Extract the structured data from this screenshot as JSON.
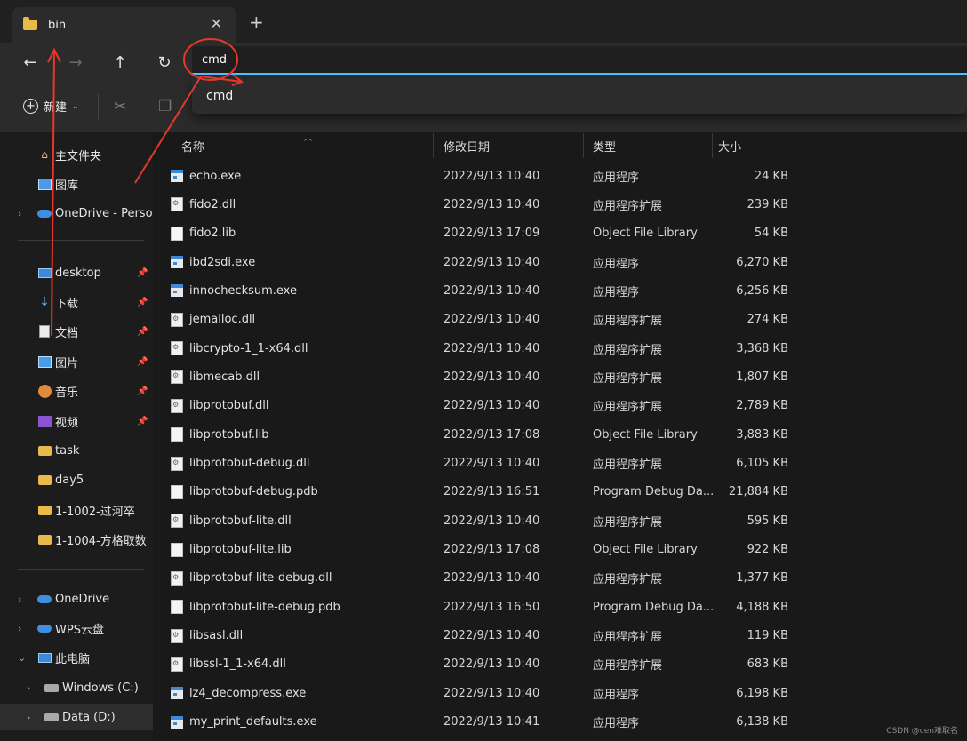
{
  "tab": {
    "title": "bin",
    "close": "✕",
    "new_tab": "+"
  },
  "nav": {
    "back": "←",
    "forward": "→",
    "up": "↑",
    "refresh": "↻"
  },
  "address": {
    "value": "cmd",
    "suggestion": "cmd"
  },
  "command_bar": {
    "new_label": "新建"
  },
  "sidebar": {
    "quick": [
      {
        "label": "主文件夹",
        "icon": "home-icon"
      },
      {
        "label": "图库",
        "icon": "gallery-icon"
      },
      {
        "label": "OneDrive - Persor",
        "icon": "onedrive-icon"
      }
    ],
    "pinned": [
      {
        "label": "desktop",
        "icon": "desktop-icon"
      },
      {
        "label": "下载",
        "icon": "downloads-icon"
      },
      {
        "label": "文档",
        "icon": "documents-icon"
      },
      {
        "label": "图片",
        "icon": "pictures-icon"
      },
      {
        "label": "音乐",
        "icon": "music-icon"
      },
      {
        "label": "视频",
        "icon": "videos-icon"
      }
    ],
    "folders": [
      {
        "label": "task"
      },
      {
        "label": "day5"
      },
      {
        "label": "1-1002-过河卒"
      },
      {
        "label": "1-1004-方格取数"
      }
    ],
    "locations": [
      {
        "label": "OneDrive",
        "icon": "onedrive-icon"
      },
      {
        "label": "WPS云盘",
        "icon": "cloud-drive-icon"
      },
      {
        "label": "此电脑",
        "icon": "this-pc-icon"
      },
      {
        "label": "Windows (C:)",
        "icon": "drive-icon"
      },
      {
        "label": "Data (D:)",
        "icon": "drive-icon"
      }
    ]
  },
  "columns": {
    "name": "名称",
    "date": "修改日期",
    "type": "类型",
    "size": "大小"
  },
  "files": [
    {
      "name": "echo.exe",
      "date": "2022/9/13 10:40",
      "type": "应用程序",
      "size": "24 KB",
      "icon": "exe"
    },
    {
      "name": "fido2.dll",
      "date": "2022/9/13 10:40",
      "type": "应用程序扩展",
      "size": "239 KB",
      "icon": "dll"
    },
    {
      "name": "fido2.lib",
      "date": "2022/9/13 17:09",
      "type": "Object File Library",
      "size": "54 KB",
      "icon": "lib"
    },
    {
      "name": "ibd2sdi.exe",
      "date": "2022/9/13 10:40",
      "type": "应用程序",
      "size": "6,270 KB",
      "icon": "exe"
    },
    {
      "name": "innochecksum.exe",
      "date": "2022/9/13 10:40",
      "type": "应用程序",
      "size": "6,256 KB",
      "icon": "exe"
    },
    {
      "name": "jemalloc.dll",
      "date": "2022/9/13 10:40",
      "type": "应用程序扩展",
      "size": "274 KB",
      "icon": "dll"
    },
    {
      "name": "libcrypto-1_1-x64.dll",
      "date": "2022/9/13 10:40",
      "type": "应用程序扩展",
      "size": "3,368 KB",
      "icon": "dll"
    },
    {
      "name": "libmecab.dll",
      "date": "2022/9/13 10:40",
      "type": "应用程序扩展",
      "size": "1,807 KB",
      "icon": "dll"
    },
    {
      "name": "libprotobuf.dll",
      "date": "2022/9/13 10:40",
      "type": "应用程序扩展",
      "size": "2,789 KB",
      "icon": "dll"
    },
    {
      "name": "libprotobuf.lib",
      "date": "2022/9/13 17:08",
      "type": "Object File Library",
      "size": "3,883 KB",
      "icon": "lib"
    },
    {
      "name": "libprotobuf-debug.dll",
      "date": "2022/9/13 10:40",
      "type": "应用程序扩展",
      "size": "6,105 KB",
      "icon": "dll"
    },
    {
      "name": "libprotobuf-debug.pdb",
      "date": "2022/9/13 16:51",
      "type": "Program Debug Da...",
      "size": "21,884 KB",
      "icon": "pdb"
    },
    {
      "name": "libprotobuf-lite.dll",
      "date": "2022/9/13 10:40",
      "type": "应用程序扩展",
      "size": "595 KB",
      "icon": "dll"
    },
    {
      "name": "libprotobuf-lite.lib",
      "date": "2022/9/13 17:08",
      "type": "Object File Library",
      "size": "922 KB",
      "icon": "lib"
    },
    {
      "name": "libprotobuf-lite-debug.dll",
      "date": "2022/9/13 10:40",
      "type": "应用程序扩展",
      "size": "1,377 KB",
      "icon": "dll"
    },
    {
      "name": "libprotobuf-lite-debug.pdb",
      "date": "2022/9/13 16:50",
      "type": "Program Debug Da...",
      "size": "4,188 KB",
      "icon": "pdb"
    },
    {
      "name": "libsasl.dll",
      "date": "2022/9/13 10:40",
      "type": "应用程序扩展",
      "size": "119 KB",
      "icon": "dll"
    },
    {
      "name": "libssl-1_1-x64.dll",
      "date": "2022/9/13 10:40",
      "type": "应用程序扩展",
      "size": "683 KB",
      "icon": "dll"
    },
    {
      "name": "lz4_decompress.exe",
      "date": "2022/9/13 10:40",
      "type": "应用程序",
      "size": "6,198 KB",
      "icon": "exe"
    },
    {
      "name": "my_print_defaults.exe",
      "date": "2022/9/13 10:41",
      "type": "应用程序",
      "size": "6,138 KB",
      "icon": "exe"
    }
  ],
  "watermark": "CSDN @cen难取名",
  "colors": {
    "accent": "#4cc2ff",
    "annotation": "#e8372a",
    "folder": "#e9b949"
  }
}
